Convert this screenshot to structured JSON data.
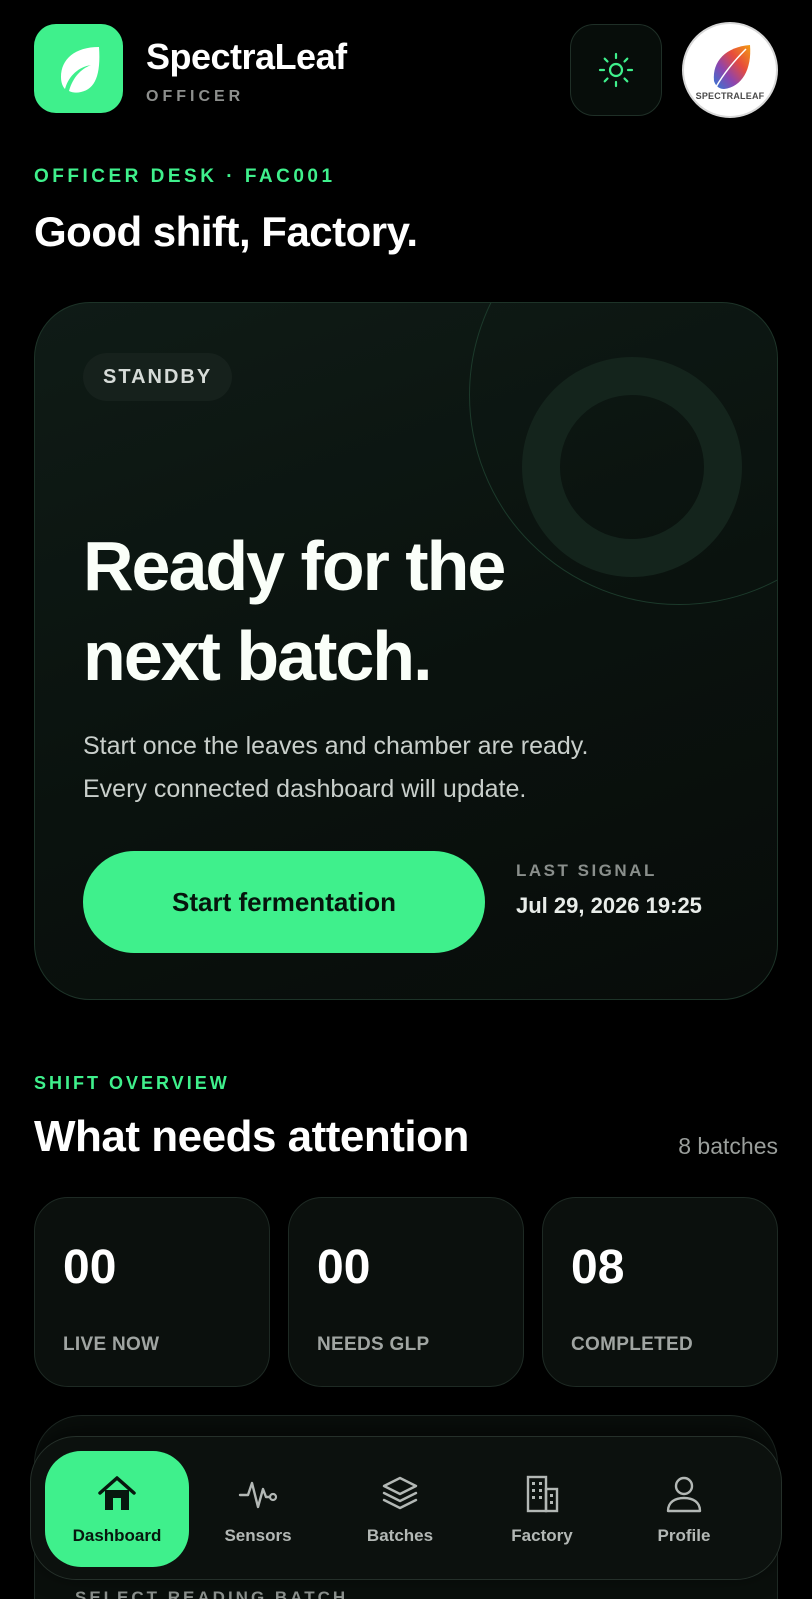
{
  "header": {
    "app_name": "SpectraLeaf",
    "role": "OFFICER",
    "avatar_text": "SPECTRALEAF",
    "icons": {
      "logo": "leaf-icon",
      "theme": "sun-icon"
    }
  },
  "intro": {
    "eyebrow": "OFFICER DESK · FAC001",
    "greeting": "Good shift, Factory."
  },
  "hero": {
    "status": "STANDBY",
    "title_line1": "Ready for the",
    "title_line2": "next batch.",
    "desc_line1": "Start once the leaves and chamber are ready.",
    "desc_line2": "Every connected dashboard will update.",
    "button_label": "Start fermentation",
    "signal_label": "LAST SIGNAL",
    "signal_value": "Jul 29, 2026 19:25"
  },
  "overview": {
    "eyebrow": "SHIFT OVERVIEW",
    "title": "What needs attention",
    "count": "8 batches",
    "stats": [
      {
        "value": "00",
        "label": "LIVE NOW"
      },
      {
        "value": "00",
        "label": "NEEDS GLP"
      },
      {
        "value": "08",
        "label": "COMPLETED"
      }
    ]
  },
  "next_card": {
    "label": "SELECT READING BATCH"
  },
  "nav": {
    "items": [
      {
        "label": "Dashboard",
        "icon": "home-icon",
        "active": true
      },
      {
        "label": "Sensors",
        "icon": "pulse-icon",
        "active": false
      },
      {
        "label": "Batches",
        "icon": "layers-icon",
        "active": false
      },
      {
        "label": "Factory",
        "icon": "building-icon",
        "active": false
      },
      {
        "label": "Profile",
        "icon": "user-icon",
        "active": false
      }
    ]
  },
  "colors": {
    "accent": "#3ff08c",
    "background": "#000000",
    "card": "#0a120e",
    "muted_text": "#9a9e9b"
  }
}
